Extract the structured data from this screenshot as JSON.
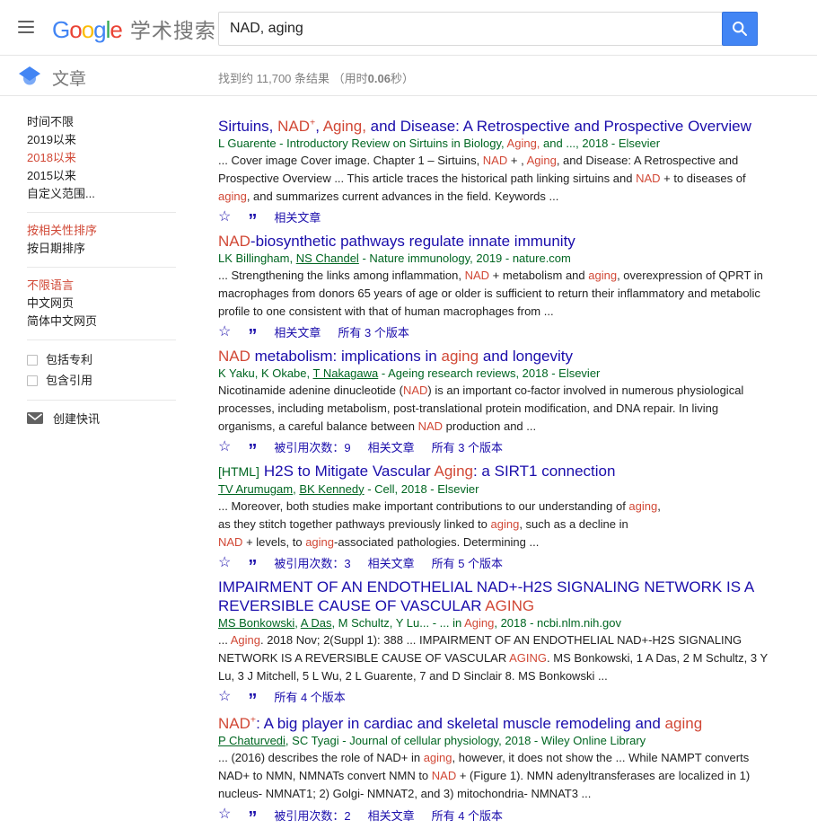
{
  "colors": {
    "brand_blue": "#4285f4",
    "link_blue": "#1a0dab",
    "term_red": "#d14836",
    "author_green": "#006621",
    "muted_gray": "#777777"
  },
  "icons": {
    "star": "☆",
    "quote": "”"
  },
  "header": {
    "logo_letters": [
      {
        "t": "G",
        "c": "lb"
      },
      {
        "t": "o",
        "c": "lr"
      },
      {
        "t": "o",
        "c": "ly"
      },
      {
        "t": "g",
        "c": "lb"
      },
      {
        "t": "l",
        "c": "lg"
      },
      {
        "t": "e",
        "c": "lr"
      }
    ],
    "logo_suffix": "学术搜索",
    "search": {
      "value": "NAD, aging"
    }
  },
  "toolbar": {
    "tab_label": "文章",
    "stats": [
      {
        "t": "找到约 11,700 条结果 （用时"
      },
      {
        "t": "0.06",
        "c": "b"
      },
      {
        "t": "秒）"
      }
    ]
  },
  "sidebar": {
    "groups": [
      {
        "items": [
          {
            "label": "时间不限"
          },
          {
            "label": "2019以来"
          },
          {
            "label": "2018以来",
            "sel": "sel"
          },
          {
            "label": "2015以来"
          },
          {
            "label": "自定义范围..."
          }
        ]
      },
      {
        "items": [
          {
            "label": "按相关性排序",
            "sel": "sel"
          },
          {
            "label": "按日期排序"
          }
        ]
      },
      {
        "items": [
          {
            "label": "不限语言",
            "sel": "sel"
          },
          {
            "label": "中文网页"
          },
          {
            "label": "简体中文网页"
          }
        ]
      }
    ],
    "checkboxes": [
      {
        "label": "包括专利"
      },
      {
        "label": "包含引用"
      }
    ],
    "alert": {
      "label": "创建快讯"
    }
  },
  "results": [
    {
      "title": [
        {
          "t": "Sirtuins, "
        },
        {
          "t": "NAD",
          "c": "hl"
        },
        {
          "t": "+",
          "c": "hl sup"
        },
        {
          "t": ", "
        },
        {
          "t": "Aging,",
          "c": "hl"
        },
        {
          "t": " and Disease: A Retrospective and Prospective Overview"
        }
      ],
      "authors": [
        {
          "t": "L Guarente - Introductory Review on Sirtuins in Biology, "
        },
        {
          "t": "Aging,",
          "c": "hl"
        },
        {
          "t": " and ..., 2018 - Elsevier"
        }
      ],
      "snippet": [
        {
          "t": "... Cover image Cover image. Chapter 1 – Sirtuins, "
        },
        {
          "t": "NAD",
          "c": "hl"
        },
        {
          "t": " + , "
        },
        {
          "t": "Aging",
          "c": "hl"
        },
        {
          "t": ", and Disease: A Retrospective and Prospective Overview ... This article traces the historical path linking sirtuins and "
        },
        {
          "t": "NAD",
          "c": "hl"
        },
        {
          "t": " + to diseases of "
        },
        {
          "t": "aging",
          "c": "hl"
        },
        {
          "t": ", and summarizes current advances in the field. Keywords ..."
        }
      ],
      "actions": [
        {
          "label": "相关文章"
        }
      ]
    },
    {
      "title": [
        {
          "t": "NAD",
          "c": "hl"
        },
        {
          "t": "-biosynthetic pathways regulate innate immunity"
        }
      ],
      "authors": [
        {
          "t": "LK Billingham, "
        },
        {
          "t": "NS Chandel",
          "c": "u"
        },
        {
          "t": " - Nature immunology, 2019 - nature.com"
        }
      ],
      "snippet": [
        {
          "t": "... Strengthening the links among inflammation, "
        },
        {
          "t": "NAD",
          "c": "hl"
        },
        {
          "t": " + metabolism and "
        },
        {
          "t": "aging",
          "c": "hl"
        },
        {
          "t": ", overexpression of QPRT in macrophages from donors 65 years of age or older is sufficient to return their inflammatory and metabolic profile to one consistent with that of human macrophages from ..."
        }
      ],
      "actions": [
        {
          "label": "相关文章"
        },
        {
          "label": "所有 3 个版本"
        }
      ]
    },
    {
      "title": [
        {
          "t": "NAD",
          "c": "hl"
        },
        {
          "t": " metabolism: implications in "
        },
        {
          "t": "aging",
          "c": "hl"
        },
        {
          "t": " and longevity"
        }
      ],
      "authors": [
        {
          "t": "K Yaku, K Okabe, "
        },
        {
          "t": "T Nakagawa",
          "c": "u"
        },
        {
          "t": " - Ageing research reviews, 2018 - Elsevier"
        }
      ],
      "snippet": [
        {
          "t": "Nicotinamide adenine dinucleotide ("
        },
        {
          "t": "NAD",
          "c": "hl"
        },
        {
          "t": ") is an important co-factor involved in numerous physiological processes, including metabolism, post-translational protein modification, and DNA repair. In living organisms, a careful balance between "
        },
        {
          "t": "NAD",
          "c": "hl"
        },
        {
          "t": " production and ..."
        }
      ],
      "actions": [
        {
          "label": "被引用次数：9"
        },
        {
          "label": "相关文章"
        },
        {
          "label": "所有 3 个版本"
        }
      ]
    },
    {
      "label": "[HTML]",
      "title": [
        {
          "t": "H2S to Mitigate Vascular "
        },
        {
          "t": "Aging",
          "c": "hl"
        },
        {
          "t": ": a SIRT1 connection"
        }
      ],
      "authors": [
        {
          "t": "TV Arumugam",
          "c": "u"
        },
        {
          "t": ", "
        },
        {
          "t": "BK Kennedy",
          "c": "u"
        },
        {
          "t": " - Cell, 2018 - Elsevier"
        }
      ],
      "snippet": [
        {
          "t": "... Moreover, both studies make important contributions to our understanding of "
        },
        {
          "t": "aging",
          "c": "hl"
        },
        {
          "t": ","
        },
        {
          "br": true
        },
        {
          "t": "as they stitch together pathways previously linked to "
        },
        {
          "t": "aging",
          "c": "hl"
        },
        {
          "t": ", such as a decline in"
        },
        {
          "br": true
        },
        {
          "t": "NAD",
          "c": "hl"
        },
        {
          "t": " + levels, to "
        },
        {
          "t": "aging",
          "c": "hl"
        },
        {
          "t": "-associated pathologies. Determining ..."
        }
      ],
      "actions": [
        {
          "label": "被引用次数：3"
        },
        {
          "label": "相关文章"
        },
        {
          "label": "所有 5 个版本"
        }
      ]
    },
    {
      "title": [
        {
          "t": "IMPAIRMENT OF AN ENDOTHELIAL NAD+-H2S SIGNALING NETWORK IS A REVERSIBLE CAUSE OF VASCULAR "
        },
        {
          "t": "AGING",
          "c": "hl"
        }
      ],
      "authors": [
        {
          "t": "MS Bonkowski",
          "c": "u"
        },
        {
          "t": ", "
        },
        {
          "t": "A Das",
          "c": "u"
        },
        {
          "t": ", M Schultz, Y Lu... - ... in "
        },
        {
          "t": "Aging",
          "c": "hl"
        },
        {
          "t": ", 2018 - ncbi.nlm.nih.gov"
        }
      ],
      "snippet": [
        {
          "t": "... "
        },
        {
          "t": "Aging",
          "c": "hl"
        },
        {
          "t": ". 2018 Nov; 2(Suppl 1): 388 ... IMPAIRMENT OF AN ENDOTHELIAL NAD+-H2S SIGNALING NETWORK IS A REVERSIBLE CAUSE OF VASCULAR "
        },
        {
          "t": "AGING",
          "c": "hl"
        },
        {
          "t": ". MS Bonkowski, 1 A Das, 2 M Schultz, 3 Y Lu, 3 J Mitchell, 5 L Wu, 2 L Guarente, 7 and D Sinclair 8. MS Bonkowski ..."
        }
      ],
      "actions": [
        {
          "label": "所有 4 个版本"
        }
      ]
    },
    {
      "title": [
        {
          "t": "NAD",
          "c": "hl"
        },
        {
          "t": "+",
          "c": "hl sup"
        },
        {
          "t": ": A big player in cardiac and skeletal muscle remodeling and "
        },
        {
          "t": "aging",
          "c": "hl"
        }
      ],
      "authors": [
        {
          "t": "P Chaturvedi",
          "c": "u"
        },
        {
          "t": ", SC Tyagi - Journal of cellular physiology, 2018 - Wiley Online Library"
        }
      ],
      "snippet": [
        {
          "t": "... (2016) describes the role of NAD+ in "
        },
        {
          "t": "aging",
          "c": "hl"
        },
        {
          "t": ", however, it does not show the ... While NAMPT converts NAD+ to NMN, NMNATs convert NMN to "
        },
        {
          "t": "NAD",
          "c": "hl"
        },
        {
          "t": " + (Figure 1). NMN adenyltransferases are localized in 1) nucleus- NMNAT1; 2) Golgi- NMNAT2, and 3) mitochondria- NMNAT3 ..."
        }
      ],
      "actions": [
        {
          "label": "被引用次数：2"
        },
        {
          "label": "相关文章"
        },
        {
          "label": "所有 4 个版本"
        }
      ]
    }
  ]
}
